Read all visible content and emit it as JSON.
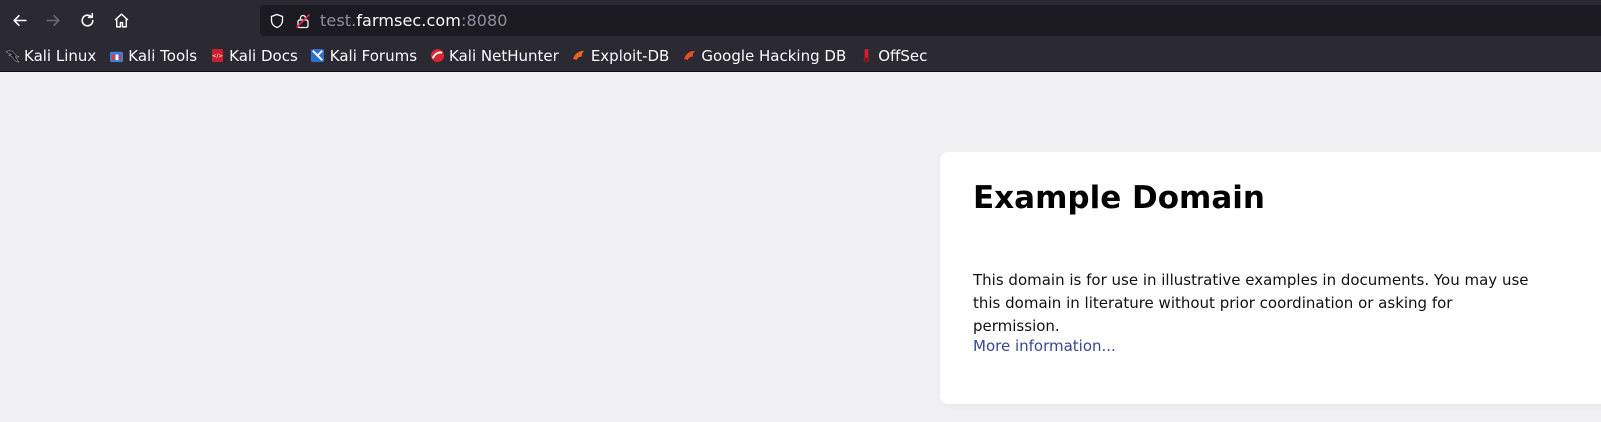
{
  "browser": {
    "url": {
      "prefix": "test.",
      "host": "farmsec.com",
      "suffix": ":8080"
    },
    "nav_icons": [
      "back-icon",
      "forward-icon",
      "reload-icon",
      "home-icon"
    ],
    "url_icons": [
      "shield-icon",
      "insecure-lock-icon"
    ]
  },
  "bookmarks": [
    {
      "label": "Kali Linux",
      "icon": "kali-dragon-icon"
    },
    {
      "label": "Kali Tools",
      "icon": "kali-tools-icon"
    },
    {
      "label": "Kali Docs",
      "icon": "kali-docs-icon"
    },
    {
      "label": "Kali Forums",
      "icon": "kali-forums-icon"
    },
    {
      "label": "Kali NetHunter",
      "icon": "nethunter-icon"
    },
    {
      "label": "Exploit-DB",
      "icon": "exploit-db-icon"
    },
    {
      "label": "Google Hacking DB",
      "icon": "ghdb-icon"
    },
    {
      "label": "OffSec",
      "icon": "offsec-icon"
    }
  ],
  "page": {
    "title": "Example Domain",
    "description": "This domain is for use in illustrative examples in documents. You may use this domain in literature without prior coordination or asking for permission.",
    "link_text": "More information..."
  },
  "colors": {
    "toolbar_bg": "#2b2a33",
    "urlbar_bg": "#1c1b22",
    "page_bg": "#f0f0f2",
    "link": "#38488f"
  }
}
